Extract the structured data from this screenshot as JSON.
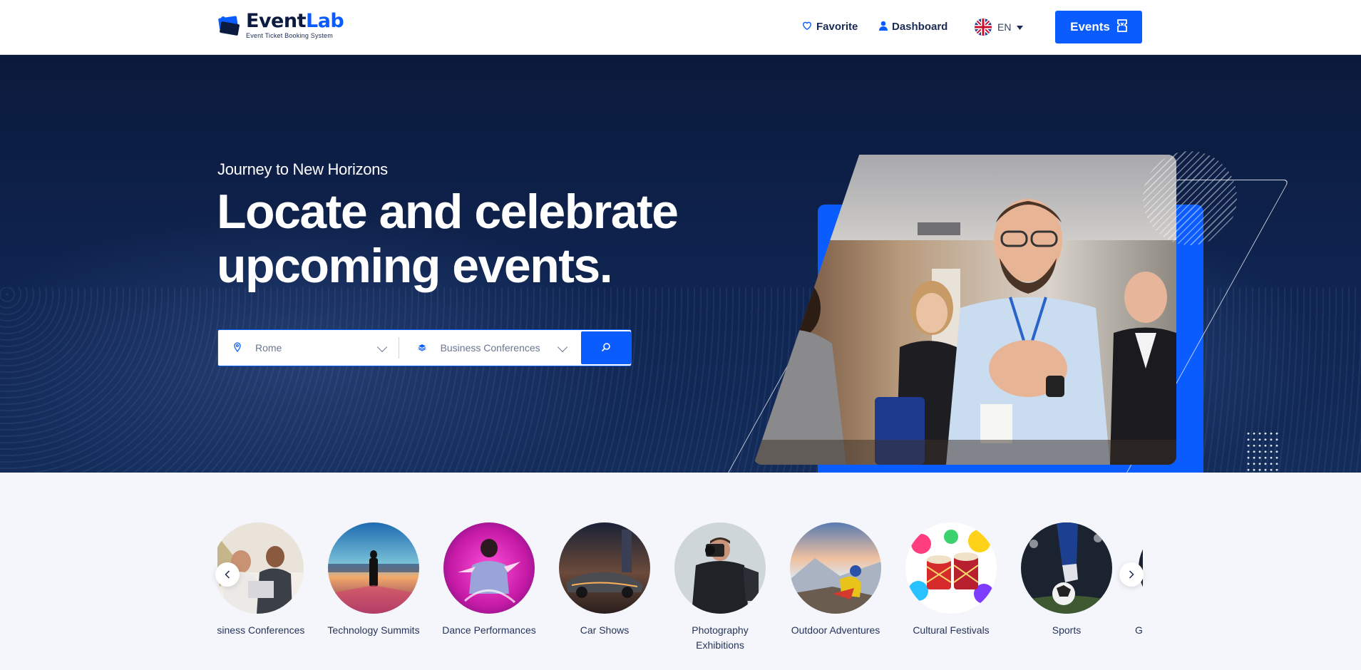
{
  "header": {
    "logo": {
      "name_main": "Event",
      "name_accent": "Lab",
      "tagline": "Event Ticket Booking System"
    },
    "nav": {
      "favorite": "Favorite",
      "dashboard": "Dashboard"
    },
    "language": {
      "code": "EN"
    },
    "events_button": "Events",
    "icons": {
      "favorite": "heart-icon",
      "dashboard": "user-icon",
      "language": "uk-flag-icon",
      "events": "ticket-icon"
    }
  },
  "hero": {
    "subtitle": "Journey to New Horizons",
    "title": "Locate and celebrate upcoming events.",
    "search": {
      "location_value": "Rome",
      "category_value": "Business Conferences",
      "location_icon": "map-pin-icon",
      "category_icon": "layers-icon",
      "button_icon": "search-icon"
    }
  },
  "categories": {
    "items": [
      {
        "label": "usiness Conferences"
      },
      {
        "label": "Technology Summits"
      },
      {
        "label": "Dance Performances"
      },
      {
        "label": "Car Shows"
      },
      {
        "label": "Photography Exhibitions"
      },
      {
        "label": "Outdoor Adventures"
      },
      {
        "label": "Cultural Festivals"
      },
      {
        "label": "Sports"
      },
      {
        "label": "G"
      }
    ]
  },
  "colors": {
    "brand": "#0b5cff",
    "navy": "#0b1b3f"
  }
}
